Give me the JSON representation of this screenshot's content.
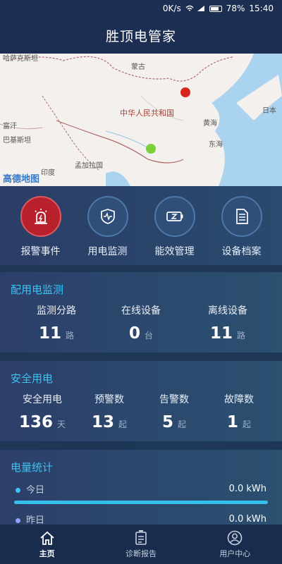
{
  "status_bar": {
    "network_speed": "0K/s",
    "battery": "78%",
    "time": "15:40"
  },
  "header": {
    "title": "胜顶电管家"
  },
  "map": {
    "labels": {
      "mongolia": "蒙古",
      "china": "中华人民共和国",
      "japan": "日本",
      "yellow_sea": "黄海",
      "east_sea": "东海",
      "india": "印度",
      "bangladesh": "孟加拉国",
      "pakistan": "巴基斯坦",
      "fuhan": "富汗",
      "kazakh": "哈萨克斯坦"
    },
    "logo": "高德地图"
  },
  "quick_actions": [
    {
      "label": "报警事件",
      "icon": "alarm-siren-icon"
    },
    {
      "label": "用电监测",
      "icon": "shield-monitor-icon"
    },
    {
      "label": "能效管理",
      "icon": "battery-efficiency-icon"
    },
    {
      "label": "设备档案",
      "icon": "document-icon"
    }
  ],
  "distribution": {
    "title": "配用电监测",
    "stats": [
      {
        "label": "监测分路",
        "value": "11",
        "unit": "路"
      },
      {
        "label": "在线设备",
        "value": "0",
        "unit": "台"
      },
      {
        "label": "离线设备",
        "value": "11",
        "unit": "路"
      }
    ]
  },
  "safety": {
    "title": "安全用电",
    "stats": [
      {
        "label": "安全用电",
        "value": "136",
        "unit": "天"
      },
      {
        "label": "预警数",
        "value": "13",
        "unit": "起"
      },
      {
        "label": "告警数",
        "value": "5",
        "unit": "起"
      },
      {
        "label": "故障数",
        "value": "1",
        "unit": "起"
      }
    ]
  },
  "energy": {
    "title": "电量统计",
    "rows": [
      {
        "label": "今日",
        "value": "0.0 kWh",
        "dot_color": "#3fc3f2"
      },
      {
        "label": "昨日",
        "value": "0.0 kWh",
        "dot_color": "#8fa3ff"
      }
    ]
  },
  "bottom_nav": [
    {
      "label": "主页",
      "icon": "home-icon",
      "active": true
    },
    {
      "label": "诊断报告",
      "icon": "report-icon",
      "active": false
    },
    {
      "label": "用户中心",
      "icon": "user-icon",
      "active": false
    }
  ],
  "colors": {
    "accent": "#3ec2f0",
    "alarm_red": "#b8202b",
    "map_dot_red": "#d9261c",
    "map_dot_green": "#7cd13a"
  }
}
